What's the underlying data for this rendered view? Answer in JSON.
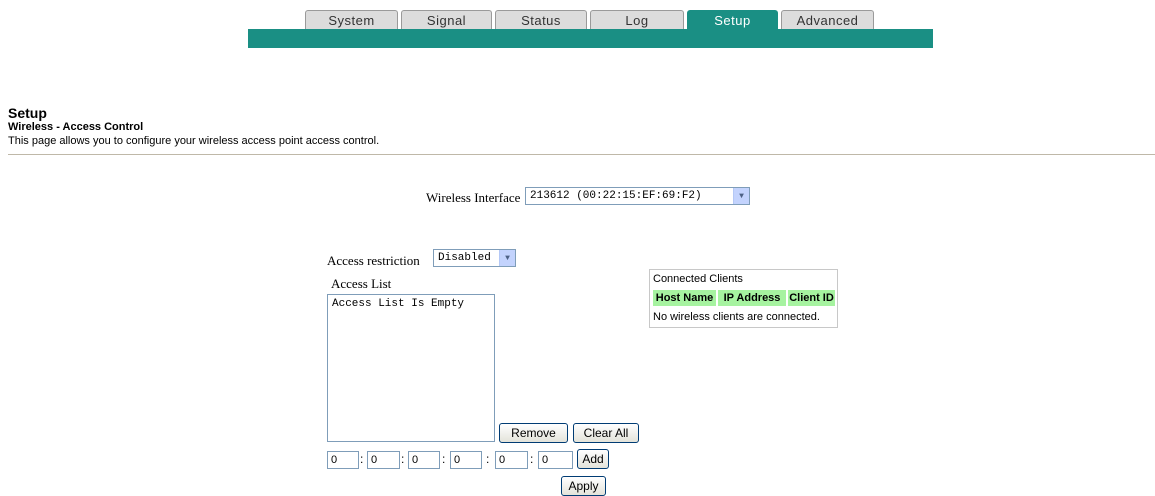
{
  "tabs": [
    {
      "label": "System"
    },
    {
      "label": "Signal"
    },
    {
      "label": "Status"
    },
    {
      "label": "Log"
    },
    {
      "label": "Setup",
      "active": true
    },
    {
      "label": "Advanced"
    }
  ],
  "header": {
    "title": "Setup",
    "subtitle": "Wireless - Access Control",
    "description": "This page allows you to configure your wireless access point access control."
  },
  "wireless_interface": {
    "label": "Wireless Interface",
    "value": "213612 (00:22:15:EF:69:F2)"
  },
  "access_restriction": {
    "label": "Access restriction",
    "value": "Disabled"
  },
  "access_list": {
    "label": "Access List",
    "items": [
      "Access List Is Empty"
    ]
  },
  "buttons": {
    "remove": "Remove",
    "clear_all": "Clear All",
    "add": "Add",
    "apply": "Apply"
  },
  "mac_fields": [
    "0",
    "0",
    "0",
    "0",
    "0",
    "0"
  ],
  "connected_clients": {
    "title": "Connected Clients",
    "columns": [
      "Host Name",
      "IP Address",
      "Client ID"
    ],
    "empty_message": "No wireless clients are connected."
  },
  "colors": {
    "accent": "#1a8f84",
    "table_header": "#a6f3a0"
  }
}
